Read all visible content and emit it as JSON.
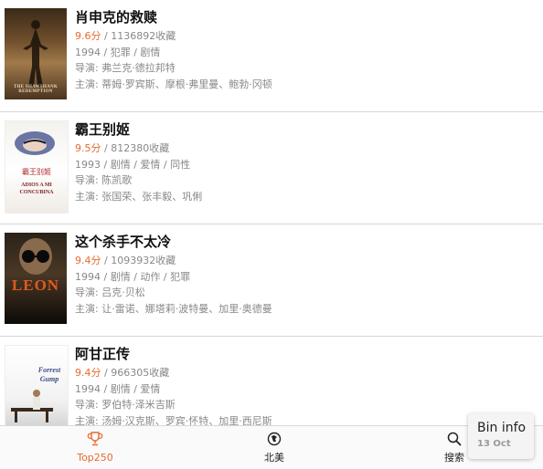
{
  "movies": [
    {
      "title": "肖申克的救赎",
      "score": "9.6分",
      "collections": " / 1136892收藏",
      "meta": "1994 / 犯罪 / 剧情",
      "director": "导演: 弗兰克·德拉邦特",
      "cast": "主演: 蒂姆·罗宾斯、摩根·弗里曼、鲍勃·冈顿",
      "poster_text": "THE SHAWSHANK REDEMPTION"
    },
    {
      "title": "霸王别姬",
      "score": "9.5分",
      "collections": " / 812380收藏",
      "meta": "1993 / 剧情 / 爱情 / 同性",
      "director": "导演: 陈凯歌",
      "cast": "主演: 张国荣、张丰毅、巩俐",
      "poster_text": "ADIOS A MI CONCUBINA"
    },
    {
      "title": "这个杀手不太冷",
      "score": "9.4分",
      "collections": " / 1093932收藏",
      "meta": "1994 / 剧情 / 动作 / 犯罪",
      "director": "导演: 吕克·贝松",
      "cast": "主演: 让·雷诺、娜塔莉·波特曼、加里·奥德曼",
      "poster_text": "LEON"
    },
    {
      "title": "阿甘正传",
      "score": "9.4分",
      "collections": " / 966305收藏",
      "meta": "1994 / 剧情 / 爱情",
      "director": "导演: 罗伯特·泽米吉斯",
      "cast": "主演: 汤姆·汉克斯、罗宾·怀特、加里·西尼斯",
      "poster_text": "Forrest Gump"
    }
  ],
  "tabs": [
    {
      "label": "Top250",
      "icon": "trophy-icon"
    },
    {
      "label": "北美",
      "icon": "globe-icon"
    },
    {
      "label": "搜索",
      "icon": "search-icon"
    }
  ],
  "bin_info": {
    "title": "Bin info",
    "date": "13 Oct"
  },
  "colors": {
    "accent": "#e8692f",
    "separator": "#d6d6d6"
  }
}
